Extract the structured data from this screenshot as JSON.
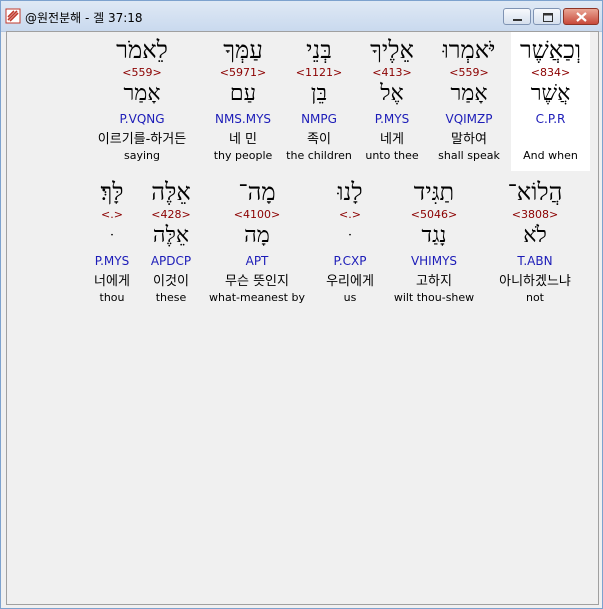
{
  "window": {
    "title": "@원전분해 - 겔 37:18"
  },
  "rows": [
    {
      "words": [
        {
          "hebrew": "וְכַאֲשֶׁר",
          "strong": "<834>",
          "root": "אֲשֶׁר",
          "morph": "C.P.R",
          "korean": "",
          "english": "And when"
        },
        {
          "hebrew": "יֹּאמְרוּ",
          "strong": "<559>",
          "root": "אָמַר",
          "morph": "VQIMZP",
          "korean": "말하여",
          "english": "shall speak"
        },
        {
          "hebrew": "אֵלֶיךָ",
          "strong": "<413>",
          "root": "אֶל",
          "morph": "P.MYS",
          "korean": "네게",
          "english": "unto thee"
        },
        {
          "hebrew": "בְּנֵי",
          "strong": "<1121>",
          "root": "בֵּן",
          "morph": "NMPG",
          "korean": "족이",
          "english": "the children"
        },
        {
          "hebrew": "עַמְּךָ",
          "strong": "<5971>",
          "root": "עַם",
          "morph": "NMS.MYS",
          "korean": "네 민",
          "english": "thy people"
        },
        {
          "hebrew": "לֵאמֹר",
          "strong": "<559>",
          "root": "אָמַר",
          "morph": "P.VQNG",
          "korean": "이르기를-하거든",
          "english": "saying"
        }
      ]
    },
    {
      "words": [
        {
          "hebrew": "הֲלוֹא־",
          "strong": "<3808>",
          "root": "לֹא",
          "morph": "T.ABN",
          "korean": "아니하겠느냐",
          "english": "not"
        },
        {
          "hebrew": "תַגִּיד",
          "strong": "<5046>",
          "root": "נָגַד",
          "morph": "VHIMYS",
          "korean": "고하지",
          "english": "wilt thou-shew"
        },
        {
          "hebrew": "לָנוּ",
          "strong": "<.>",
          "root": "ּ",
          "morph": "P.CXP",
          "korean": "우리에게",
          "english": "us"
        },
        {
          "hebrew": "מָה־",
          "strong": "<4100>",
          "root": "מָה",
          "morph": "APT",
          "korean": "무슨 뜻인지",
          "english": "what-meanest by"
        },
        {
          "hebrew": "אֵלֶּה",
          "strong": "<428>",
          "root": "אֵלֶּה",
          "morph": "APDCP",
          "korean": "이것이",
          "english": "these"
        },
        {
          "hebrew": "לָּךְ׃",
          "strong": "<.>",
          "root": "ּ",
          "morph": "P.MYS",
          "korean": "너에게",
          "english": "thou"
        }
      ]
    }
  ]
}
